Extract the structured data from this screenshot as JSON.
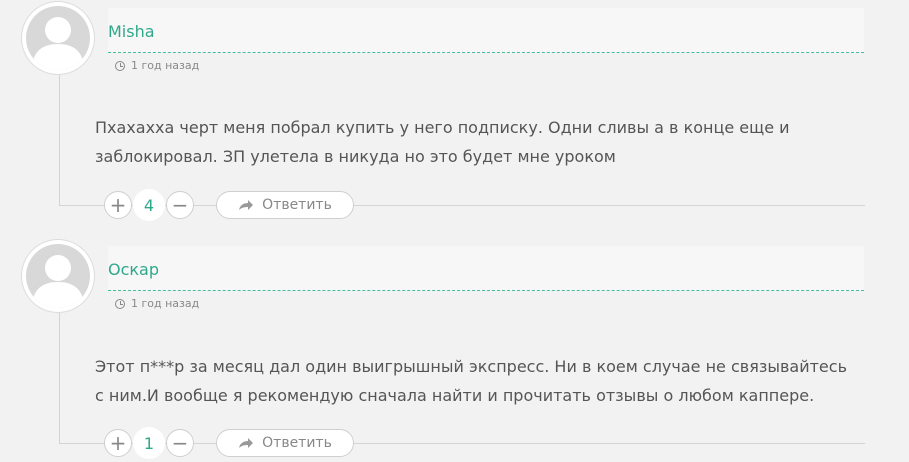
{
  "comments": [
    {
      "author": "Misha",
      "time": "1 год назад",
      "text": "Пхахахха черт меня побрал купить у него подписку. Одни сливы а в конце еще и заблокировал. ЗП улетела в никуда но это будет мне уроком",
      "votes": "4",
      "plus": "+",
      "minus": "−",
      "reply": "Ответить"
    },
    {
      "author": "Оскар",
      "time": "1 год назад",
      "text": "Этот п***р за месяц дал один выигрышный экспресс. Ни в коем случае не связывайтесь с ним.И вообще я рекомендую сначала найти и прочитать отзывы о любом каппере.",
      "votes": "1",
      "plus": "+",
      "minus": "−",
      "reply": "Ответить"
    }
  ],
  "colors": {
    "accent": "#2fa88a",
    "background": "#f2f2f2",
    "text": "#555555"
  }
}
